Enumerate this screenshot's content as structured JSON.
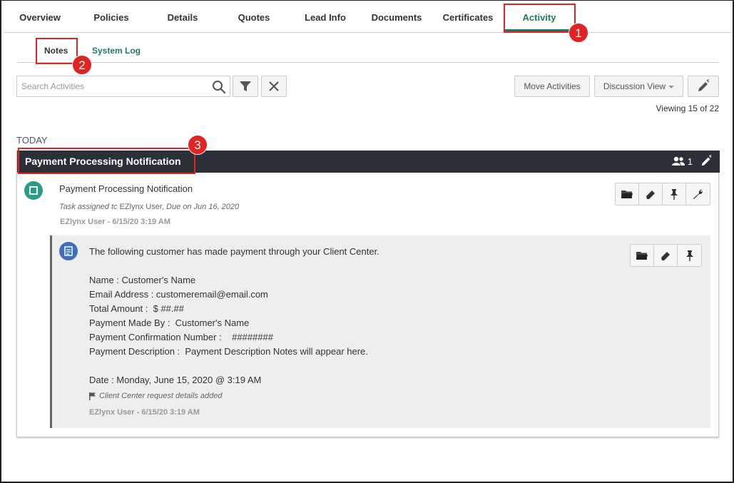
{
  "tabs": [
    {
      "label": "Overview"
    },
    {
      "label": "Policies"
    },
    {
      "label": "Details"
    },
    {
      "label": "Quotes"
    },
    {
      "label": "Lead Info"
    },
    {
      "label": "Documents"
    },
    {
      "label": "Certificates"
    },
    {
      "label": "Activity",
      "active": true
    }
  ],
  "subtabs": {
    "notes": "Notes",
    "system_log": "System Log"
  },
  "annotations": {
    "one": "1",
    "two": "2",
    "three": "3"
  },
  "toolbar": {
    "search_placeholder": "Search Activities",
    "move_label": "Move Activities",
    "discussion_label": "Discussion View",
    "viewing": "Viewing 15 of 22"
  },
  "section_label": "TODAY",
  "activity": {
    "header_title": "Payment Processing Notification",
    "participants": "1",
    "task_title": "Payment Processing Notification",
    "task_assigned_prefix": "Task assigned tc",
    "task_assigned_user": "EZlynx User,",
    "task_due": "Due on Jun 16, 2020",
    "task_author": "EZlynx User - 6/15/20 3:19 AM",
    "note": {
      "intro": "The following customer has made payment through your Client Center.",
      "name": "Name : Customer's Name",
      "email": "Email Address : customeremail@email.com",
      "amount": "Total Amount :  $ ##.##",
      "made_by": "Payment Made By :  Customer's Name",
      "confirmation": "Payment Confirmation Number :    ########",
      "description": "Payment Description :  Payment Description Notes will appear here.",
      "date": "Date : Monday, June 15, 2020 @ 3:19 AM",
      "flag_text": "Client Center request details added",
      "author": "EZlynx User - 6/15/20 3:19 AM"
    }
  },
  "colors": {
    "accent": "#1c7b5e",
    "header_bg": "#2d2f36",
    "annotation": "#e02424",
    "task_icon": "#2a9d86",
    "note_icon": "#3f6fb8"
  },
  "icons": [
    "search-icon",
    "filter-icon",
    "close-icon",
    "edit-pen-icon",
    "users-icon",
    "folder-icon",
    "eraser-icon",
    "pin-icon",
    "wrench-icon",
    "document-icon",
    "flag-icon"
  ]
}
